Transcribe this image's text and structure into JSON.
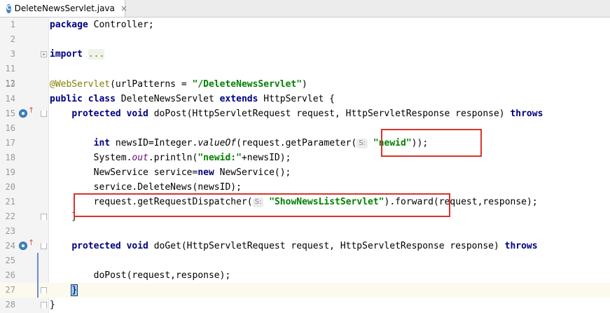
{
  "tab": {
    "icon_letter": "C",
    "title": "DeleteNewsServlet.java",
    "close": "×"
  },
  "hint_label": "S:",
  "lines": {
    "l1": {
      "num": "1",
      "kw": "package",
      "rest": " Controller;"
    },
    "l2": {
      "num": "2"
    },
    "l3": {
      "num": "3",
      "kw": "import",
      "fold": "..."
    },
    "l11": {
      "num": "11"
    },
    "l12": {
      "num": "12"
    },
    "l13": {
      "num": "13",
      "ann": "@WebServlet",
      "pre": "(urlPatterns = ",
      "str": "\"/DeleteNewsServlet\"",
      "post": ")"
    },
    "l14": {
      "num": "14",
      "kw1": "public class",
      "mid": " DeleteNewsServlet ",
      "kw2": "extends",
      "post": " HttpServlet {"
    },
    "l15": {
      "num": "15",
      "indent": "    ",
      "kw": "protected void",
      "rest": " doPost(HttpServletRequest request, HttpServletResponse response) ",
      "kw2": "throws"
    },
    "l16": {
      "num": "16"
    },
    "l17": {
      "num": "17",
      "indent": "        ",
      "kw": "int",
      "pre": " newsID=Integer.",
      "it": "valueOf",
      "mid": "(request.getParameter(",
      "str": "\"newid\"",
      "post": "));"
    },
    "l18": {
      "num": "18",
      "pre": "        System.",
      "fld": "out",
      "mid": ".println(",
      "str": "\"newid:\"",
      "post": "+newsID);"
    },
    "l19": {
      "num": "19",
      "pre": "        NewService service=",
      "kw": "new",
      "post": " NewService();"
    },
    "l20": {
      "num": "20",
      "text": "        service.DeleteNews(newsID);"
    },
    "l21": {
      "num": "21",
      "pre": "        request.getRequestDispatcher(",
      "str": "\"ShowNewsListServlet\"",
      "post": ").forward(request,response);"
    },
    "l22": {
      "num": "22",
      "text": "    }"
    },
    "l23": {
      "num": "23"
    },
    "l24": {
      "num": "24",
      "indent": "    ",
      "kw": "protected void",
      "rest": " doGet(HttpServletRequest request, HttpServletResponse response) ",
      "kw2": "throws"
    },
    "l25": {
      "num": "25"
    },
    "l26": {
      "num": "26",
      "text": "        doPost(request,response);"
    },
    "l27": {
      "num": "27",
      "indent": "    ",
      "brace": "}"
    },
    "l28": {
      "num": "28",
      "text": "}"
    }
  }
}
